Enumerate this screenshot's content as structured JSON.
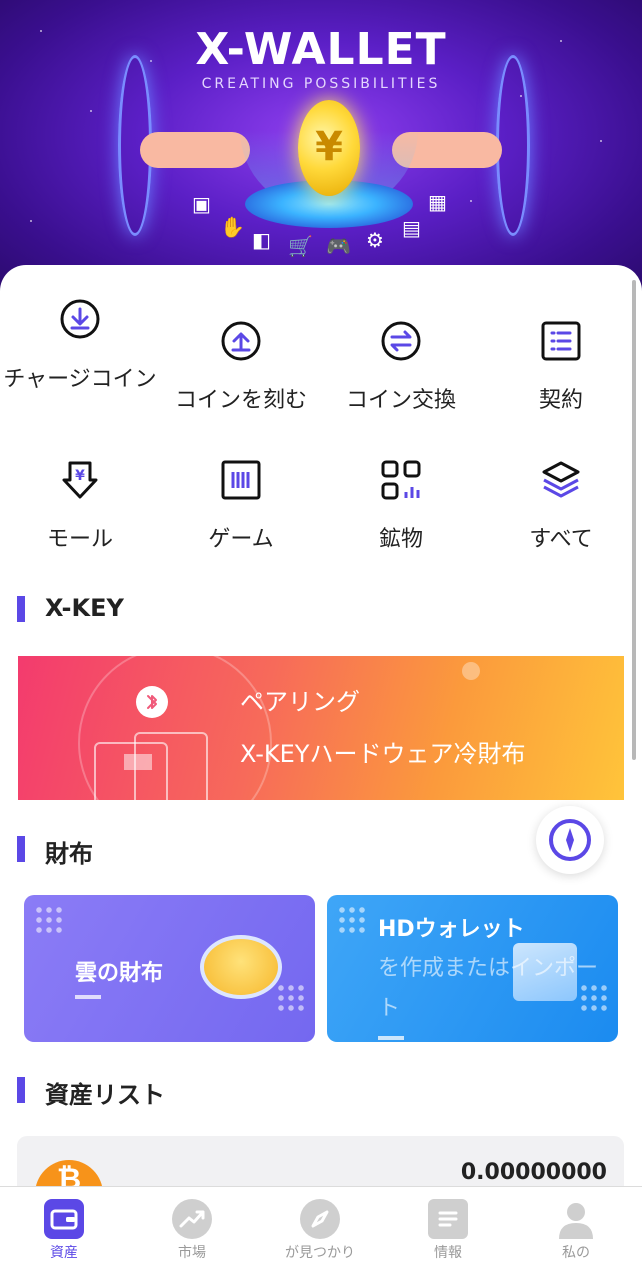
{
  "hero": {
    "title": "X-WALLET",
    "subtitle": "CREATING POSSIBILITIES"
  },
  "actions": [
    {
      "label": "チャージコイン",
      "icon": "download-circle-icon"
    },
    {
      "label": "コインを刻む",
      "icon": "upload-circle-icon"
    },
    {
      "label": "コイン交換",
      "icon": "swap-circle-icon"
    },
    {
      "label": "契約",
      "icon": "list-document-icon"
    },
    {
      "label": "モール",
      "icon": "yen-shield-icon"
    },
    {
      "label": "ゲーム",
      "icon": "barcode-box-icon"
    },
    {
      "label": "鉱物",
      "icon": "grid-chart-icon"
    },
    {
      "label": "すべて",
      "icon": "layers-icon"
    }
  ],
  "xkey": {
    "title": "X-KEY",
    "banner_line1": "ペアリング",
    "banner_line2": "X-KEYハードウェア冷財布"
  },
  "wallet": {
    "title": "財布",
    "cloud_label": "雲の財布",
    "hd_label": "HDウォレット",
    "hd_sub": "を作成またはインポート"
  },
  "assets": {
    "title": "資産リスト",
    "items": [
      {
        "value": "0.00000000"
      }
    ]
  },
  "tabs": [
    {
      "label": "資産",
      "active": true
    },
    {
      "label": "市場",
      "active": false
    },
    {
      "label": "が見つかり",
      "active": false
    },
    {
      "label": "情報",
      "active": false
    },
    {
      "label": "私の",
      "active": false
    }
  ],
  "colors": {
    "accent": "#5b48e6",
    "text": "#222222"
  }
}
